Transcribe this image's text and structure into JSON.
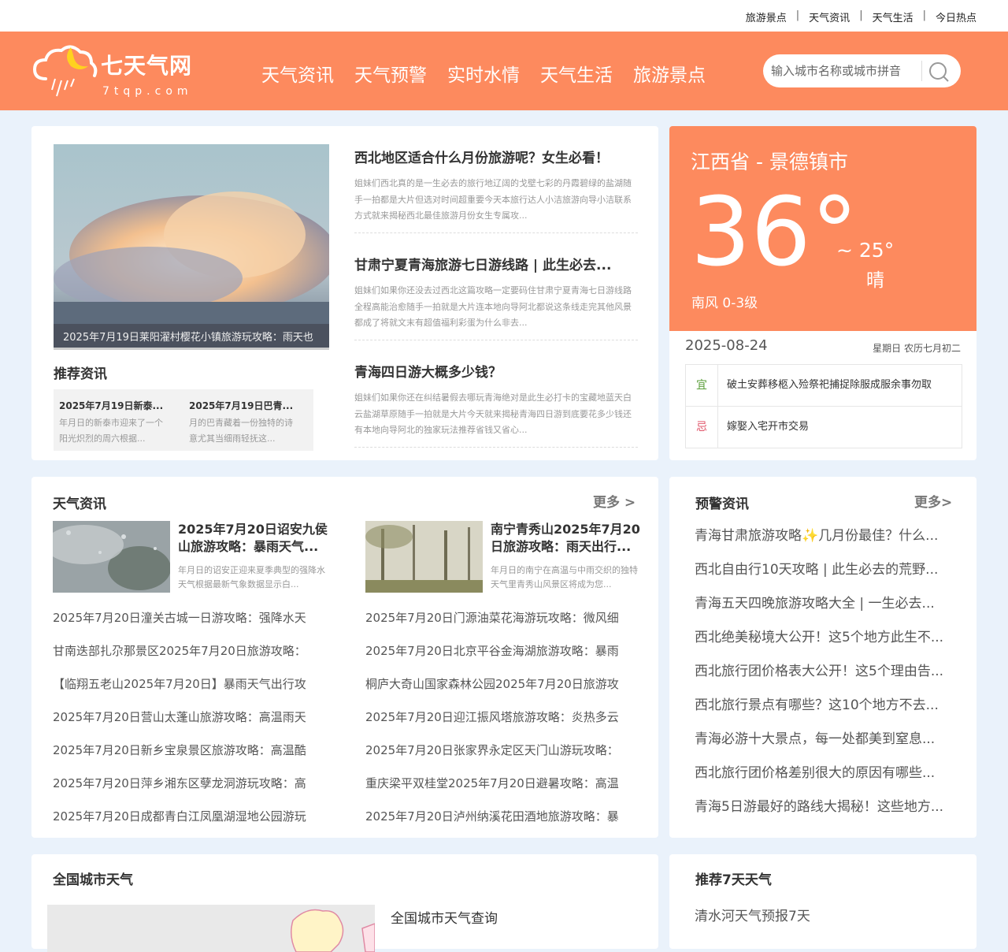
{
  "topbar": {
    "links": [
      "旅游景点",
      "天气资讯",
      "天气生活",
      "今日热点"
    ],
    "separator": "|"
  },
  "logo": {
    "name": "七天气网",
    "domain": "7tqp.com"
  },
  "nav": [
    "天气资讯",
    "天气预警",
    "实时水情",
    "天气生活",
    "旅游景点"
  ],
  "search": {
    "placeholder": "输入城市名称或城市拼音",
    "icon": "search-icon"
  },
  "hero": {
    "caption": "2025年7月19日莱阳濯村樱花小镇旅游玩攻略：雨天也"
  },
  "recommend": {
    "title": "推荐资讯",
    "items": [
      {
        "title": "2025年7月19日新泰...",
        "desc": "年月日的新泰市迎来了一个阳光炽烈的周六根据..."
      },
      {
        "title": "2025年7月19日巴青...",
        "desc": "月的巴青藏着一份独特的诗意尤其当细雨轻抚这..."
      }
    ]
  },
  "articles": [
    {
      "title": "西北地区适合什么月份旅游呢？女生必看！",
      "desc": "姐妹们西北真的是一生必去的旅行地辽阔的戈壁七彩的丹霞碧绿的盐湖随手一拍都是大片但选对时间超重要今天本旅行达人小洁旅游向导小洁联系方式就来揭秘西北最佳旅游月份女生专属攻..."
    },
    {
      "title": "甘肃宁夏青海旅游七日游线路 | 此生必去...",
      "desc": "姐妹们如果你还没去过西北这篇攻略一定要码住甘肃宁夏青海七日游线路全程高能治愈随手一拍就是大片连本地向导阿北都说这条线走完其他风景都成了将就文末有超值福利彩蛋为什么非去..."
    },
    {
      "title": "青海四日游大概多少钱？",
      "desc": "姐妹们如果你还在纠结暑假去哪玩青海绝对是此生必打卡的宝藏地蓝天白云盐湖草原随手一拍就是大片今天就来揭秘青海四日游到底要花多少钱还有本地向导阿北的独家玩法推荐省钱又省心..."
    }
  ],
  "weather": {
    "city": "江西省 - 景德镇市",
    "high": "36°",
    "low": "~ 25°",
    "condition": "晴",
    "wind": "南风  0-3级",
    "date": "2025-08-24",
    "weekday_lunar": "星期日  农历七月初二",
    "good_label": "宜",
    "good": "破土安葬移柩入殓祭祀捕捉除服成服余事勿取",
    "bad_label": "忌",
    "bad": "嫁娶入宅开市交易"
  },
  "weather_news": {
    "title": "天气资讯",
    "more": "更多 >",
    "featured": [
      {
        "title": "2025年7月20日诏安九侯山旅游攻略：暴雨天气...",
        "desc": "年月日的诏安正迎来夏季典型的强降水天气根据最新气象数据显示白..."
      },
      {
        "title": "南宁青秀山2025年7月20日旅游攻略：雨天出行...",
        "desc": "年月日的南宁在高温与中雨交织的独特天气里青秀山风景区将成为您..."
      }
    ],
    "left": [
      "2025年7月20日潼关古城一日游攻略：强降水天",
      "甘南迭部扎尕那景区2025年7月20日旅游攻略：",
      "【临翔五老山2025年7月20日】暴雨天气出行攻",
      "2025年7月20日营山太蓬山旅游攻略：高温雨天",
      "2025年7月20日新乡宝泉景区旅游攻略：高温酷",
      "2025年7月20日萍乡湘东区孽龙洞游玩攻略：高",
      "2025年7月20日成都青白江凤凰湖湿地公园游玩"
    ],
    "right": [
      "2025年7月20日门源油菜花海游玩攻略：微风细",
      "2025年7月20日北京平谷金海湖旅游攻略：暴雨",
      "桐庐大奇山国家森林公园2025年7月20日旅游攻",
      "2025年7月20日迎江振风塔旅游攻略：炎热多云",
      "2025年7月20日张家界永定区天门山游玩攻略：",
      "重庆梁平双桂堂2025年7月20日避暑攻略：高温",
      "2025年7月20日泸州纳溪花田酒地旅游攻略：暴"
    ]
  },
  "warning": {
    "title": "预警资讯",
    "more": "更多>",
    "items": [
      "青海甘肃旅游攻略✨几月份最佳？什么...",
      "西北自由行10天攻略 | 此生必去的荒野...",
      "青海五天四晚旅游攻略大全 | 一生必去...",
      "西北绝美秘境大公开！这5个地方此生不...",
      "西北旅行团价格表大公开！这5个理由告...",
      "西北旅行景点有哪些？这10个地方不去...",
      "青海必游十大景点，每一处都美到窒息...",
      "西北旅行团价格差别很大的原因有哪些...",
      "青海5日游最好的路线大揭秘！这些地方..."
    ]
  },
  "national": {
    "title": "全国城市天气",
    "query": "全国城市天气查询"
  },
  "seven_day": {
    "title": "推荐7天天气",
    "first": "清水河天气预报7天"
  }
}
